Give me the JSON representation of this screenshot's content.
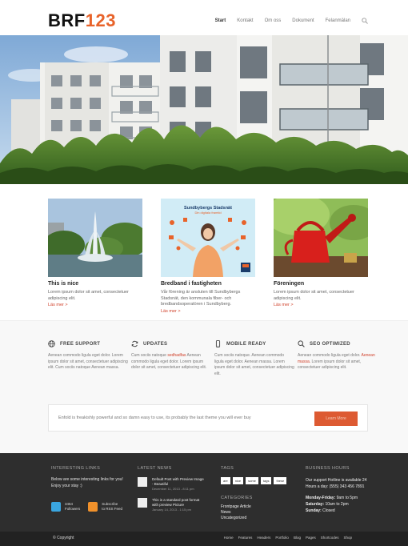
{
  "header": {
    "logo_dark": "BRF",
    "logo_accent": "123",
    "nav": [
      "Start",
      "Kontakt",
      "Om oss",
      "Dokument",
      "Felanmälan"
    ]
  },
  "posts": [
    {
      "title": "This is nice",
      "text": "Lorem ipsum dolor sit amet, consectetuer adipiscing elit.",
      "link": "Läs mer >"
    },
    {
      "title": "Bredband i fastigheten",
      "text": "Vår förening är ansluten till Sundbybergs Stadsnät, den kommunala fiber- och bredbandsoperatören i Sundbyberg.",
      "link": "Läs mer >",
      "thumb_title": "Sundbybergs Stadsnät",
      "thumb_sub": "Din digitala framtid"
    },
    {
      "title": "Föreningen",
      "text": "Lorem ipsum dolor sit amet, consectetuer adipiscing elit.",
      "link": "Läs mer >"
    }
  ],
  "features": [
    {
      "title": "FREE SUPPORT",
      "icon": "globe-icon",
      "text_pre": "Aenean commodo ligula eget dolor. Lorem ipsum dolor sit amet, consectetuer adipiscing elit. Cum sociis natoque Aenean massa.",
      "hl": "",
      "text_post": ""
    },
    {
      "title": "UPDATES",
      "icon": "refresh-icon",
      "text_pre": "Cum sociis natoque ",
      "hl": "sedhadfas",
      "text_post": " Aenean commodo ligula eget dolor. Lorem ipsum dolor sit amet, consectetuer adipiscing elit."
    },
    {
      "title": "MOBILE READY",
      "icon": "mobile-icon",
      "text_pre": "Cum sociis natoque. Aenean commodo ligula eget dolor. Aenean massa. Lorem ipsum dolor sit amet, consectetuer adipiscing elit.",
      "hl": "",
      "text_post": ""
    },
    {
      "title": "SEO OPTIMIZED",
      "icon": "search-icon",
      "text_pre": "Aenean commodo ligula eget dolor. ",
      "hl": "Aenean massa.",
      "text_post": " Lorem ipsum dolor sit amet, consectetuer adipiscing elit."
    }
  ],
  "cta": {
    "text": "Enfold is freakishly powerful and so damn easy to use, its probably the last theme you will ever buy",
    "button": "Learn More"
  },
  "footer": {
    "links": {
      "title": "INTERESTING LINKS",
      "text": "Below are some interesting links for you! Enjoy your stay :)",
      "twitter": [
        "3464",
        "Followers"
      ],
      "rss": [
        "Subscribe",
        "to RSS Feed"
      ]
    },
    "news": {
      "title": "LATEST NEWS",
      "items": [
        {
          "title": "Default Post with Preview Image - Beautiful",
          "date": "December 11, 2013 - 8:11 pm"
        },
        {
          "title": "This is a standard post format with preview Picture",
          "date": "January 14, 2013 - 1:15 pm"
        }
      ]
    },
    "tags": {
      "title": "TAGS",
      "items": [
        "are",
        "nice",
        "some",
        "tags",
        "these"
      ]
    },
    "categories": {
      "title": "CATEGORIES",
      "items": [
        "Frontpage Article",
        "News",
        "Uncategorized"
      ]
    },
    "hours": {
      "title": "BUSINESS HOURS",
      "line1": "Our support Hotline is available 24 Hours a day: (555) 343 456 7891",
      "l2": "Monday-Friday:",
      "v2": " 9am to 5pm",
      "l3": "Saturday:",
      "v3": " 10am to 2pm",
      "l4": "Sunday:",
      "v4": " Closed"
    }
  },
  "bottom": {
    "copyright": "© Copyright",
    "links": [
      "Home",
      "Features",
      "Headers",
      "Portfolio",
      "Blog",
      "Pages",
      "Shortcodes",
      "Shop"
    ]
  },
  "colors": {
    "accent": "#e8632a",
    "link": "#d0402a",
    "footer": "#2e2e2e"
  }
}
